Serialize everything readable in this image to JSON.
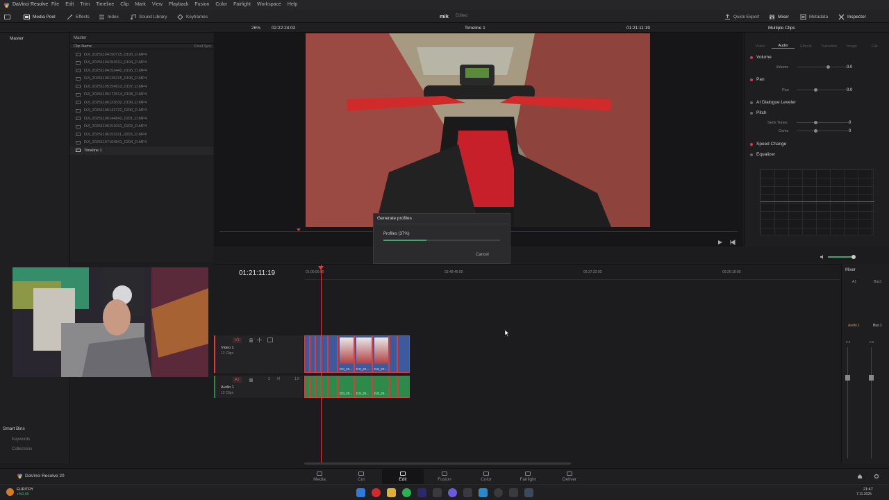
{
  "app": {
    "name": "DaVinci Resolve",
    "menus": [
      "File",
      "Edit",
      "Trim",
      "Timeline",
      "Clip",
      "Mark",
      "View",
      "Playback",
      "Fusion",
      "Color",
      "Fairlight",
      "Workspace",
      "Help"
    ]
  },
  "toolbar": {
    "media_pool": "Media Pool",
    "effects": "Effects",
    "index": "Index",
    "sound_library": "Sound Library",
    "keyframes": "Keyframes",
    "project_title": "mik",
    "project_status": "Edited",
    "quick_export": "Quick Export",
    "mixer": "Mixer",
    "metadata": "Metadata",
    "inspector": "Inspector"
  },
  "subbar": {
    "zoom": "26%",
    "source_tc": "02:22:24:02",
    "timeline_name": "Timeline 1",
    "record_tc": "01:21:11:19",
    "inspector_title": "Multiple Clips"
  },
  "bins": {
    "master": "Master",
    "smart_bins": "Smart Bins",
    "keywords": "Keywords",
    "collections": "Collections"
  },
  "media_pool": {
    "header": "Master",
    "col_name": "Clip Name",
    "col_sync": "Cloud Sync",
    "clips": [
      "DJI_20251104150715_0193_D.MP4",
      "DJI_20251104152631_0194_D.MP4",
      "DJI_20251104153442_0195_D.MP4",
      "DJI_20251105125215_0196_D.MP4",
      "DJI_20251105154913_0197_D.MP4",
      "DJI_20251105172514_0198_D.MP4",
      "DJI_20251106133032_0199_D.MP4",
      "DJI_20251106142722_0200_D.MP4",
      "DJI_20251106144842_0201_D.MP4",
      "DJI_20251106151031_0202_D.MP4",
      "DJI_20251106153211_0203_D.MP4",
      "DJI_20251107164841_0204_D.MP4"
    ],
    "timeline_item": "Timeline 1"
  },
  "dialog": {
    "title": "Generate profiles",
    "progress_label": "Profiles (37%)",
    "progress": 0.37,
    "cancel": "Cancel"
  },
  "inspector": {
    "tabs": [
      "Video",
      "Audio",
      "Effects",
      "Transition",
      "Image",
      "File"
    ],
    "volume": "Volume",
    "volume_param": "Volume",
    "volume_val": "0.0",
    "pan": "Pan",
    "pan_param": "Pan",
    "pan_val": "0.0",
    "dialogue": "AI Dialogue Leveler",
    "pitch": "Pitch",
    "semitones": "Semi Tones",
    "semitones_val": "0",
    "cents": "Cents",
    "cents_val": "0",
    "speed": "Speed Change",
    "equalizer": "Equalizer"
  },
  "timeline": {
    "timecode": "01:21:11:19",
    "ruler": [
      "01:00:00:00",
      "03:48:46:00",
      "06:37:32:00",
      "09:26:18:00"
    ],
    "v1": {
      "tag": "V1",
      "name": "Video 1",
      "count": "12 Clips"
    },
    "a1": {
      "tag": "A1",
      "name": "Audio 1",
      "count": "12 Clips",
      "level": "1.0"
    },
    "clip_label": "DJI_20..."
  },
  "mixer": {
    "title": "Mixer",
    "a1": "A1",
    "bus1": "Bus1",
    "audio1": "Audio 1",
    "bus1b": "Bus 1",
    "val_a": "0.0",
    "val_b": "0.0"
  },
  "pages": [
    "Media",
    "Cut",
    "Edit",
    "Fusion",
    "Color",
    "Fairlight",
    "Deliver"
  ],
  "pagebar_app": "DaVinci Resolve 20",
  "taskbar": {
    "ticker": "EUR/TRY",
    "ticker_val": "+%0,48",
    "time": "21:47",
    "date": "7.11.2025"
  },
  "colors": {
    "accent_red": "#e03a3a",
    "clip_video": "#3c5a9c",
    "clip_audio": "#2e8a4a"
  }
}
